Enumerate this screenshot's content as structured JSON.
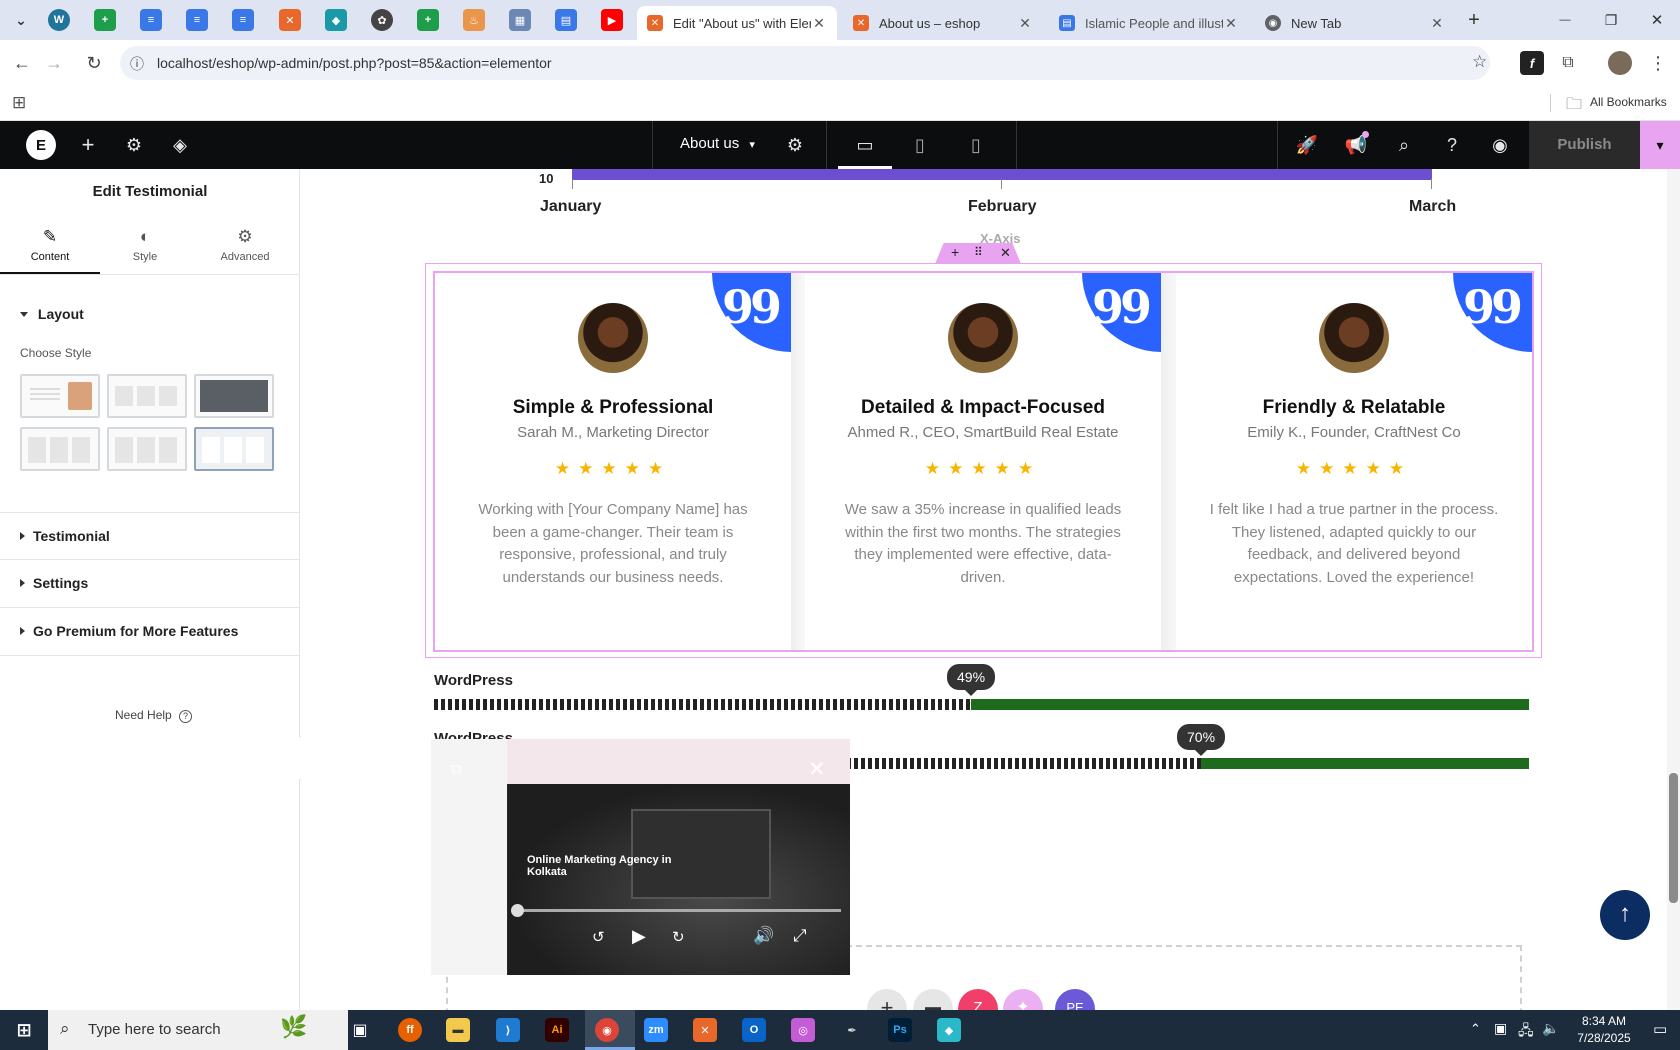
{
  "browser": {
    "tabs": [
      {
        "label": "Edit \"About us\" with Elem",
        "active": true
      },
      {
        "label": "About us – eshop",
        "active": false
      },
      {
        "label": "Islamic People and illustra",
        "active": false
      },
      {
        "label": "New Tab",
        "active": false
      }
    ],
    "url": "localhost/eshop/wp-admin/post.php?post=85&action=elementor",
    "bookmarks_label": "All Bookmarks"
  },
  "elementor": {
    "page_name": "About us",
    "publish_label": "Publish"
  },
  "panel": {
    "title": "Edit Testimonial",
    "tabs": [
      {
        "label": "Content",
        "icon": "pencil-icon"
      },
      {
        "label": "Style",
        "icon": "contrast-icon"
      },
      {
        "label": "Advanced",
        "icon": "gear-icon"
      }
    ],
    "layout_label": "Layout",
    "choose_style_label": "Choose Style",
    "sections": [
      "Testimonial",
      "Settings",
      "Go Premium for More Features"
    ],
    "need_help": "Need Help"
  },
  "chart_fragment": {
    "tick_label": "10",
    "months": [
      "January",
      "February",
      "March"
    ],
    "axis_label": "X-Axis"
  },
  "testimonials": [
    {
      "title": "Simple & Professional",
      "author": "Sarah M., Marketing Director",
      "rating": 5,
      "stars": "★★★★★",
      "quote": "Working with [Your Company Name] has been a game-changer. Their team is responsive, professional, and truly understands our business needs."
    },
    {
      "title": "Detailed & Impact-Focused",
      "author": "Ahmed R., CEO, SmartBuild Real Estate",
      "rating": 5,
      "stars": "★★★★★",
      "quote": "We saw a 35% increase in qualified leads within the first two months. The strategies they implemented were effective, data-driven."
    },
    {
      "title": "Friendly & Relatable",
      "author": "Emily K., Founder, CraftNest Co",
      "rating": 5,
      "stars": "★★★★★",
      "quote": "I felt like I had a true partner in the process. They listened, adapted quickly to our feedback, and delivered beyond expectations. Loved the experience!"
    }
  ],
  "skills": [
    {
      "label": "WordPress",
      "value": 49,
      "value_label": "49%"
    },
    {
      "label": "WordPress",
      "value": 70,
      "value_label": "70%"
    }
  ],
  "video_popup": {
    "caption": "Online Marketing Agency in Kolkata"
  },
  "taskbar": {
    "search_placeholder": "Type here to search",
    "time": "8:34 AM",
    "date": "7/28/2025"
  },
  "colors": {
    "accent_blue": "#2962ff",
    "star": "#f7b500",
    "bar_fill": "#1e6b1e",
    "chart_bar": "#6c4fd0",
    "elementor_selection": "#e8a4f0"
  }
}
